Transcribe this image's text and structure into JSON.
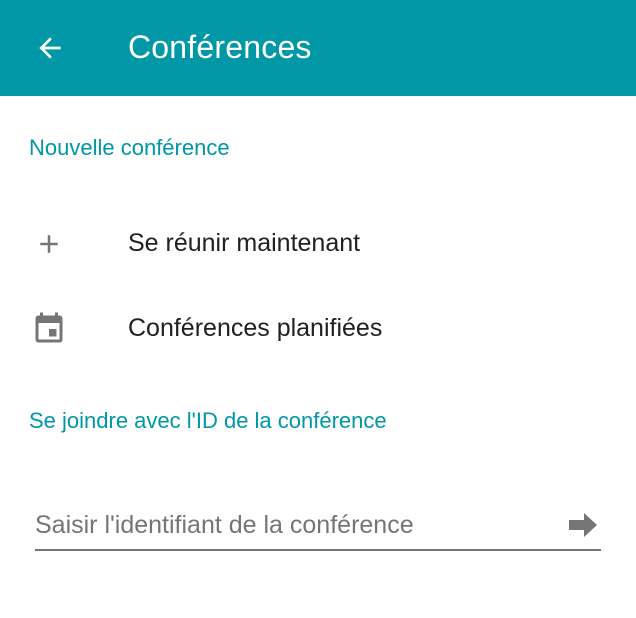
{
  "appbar": {
    "title": "Conférences",
    "back_icon": "arrow-left-icon",
    "background_color": "#0097a7"
  },
  "new_conference": {
    "header": "Nouvelle conférence",
    "items": [
      {
        "label": "Se réunir maintenant",
        "icon": "plus-icon"
      },
      {
        "label": "Conférences planifiées",
        "icon": "calendar-icon"
      }
    ]
  },
  "join": {
    "header": "Se joindre avec l'ID de la conférence",
    "input_value": "",
    "input_placeholder": "Saisir l'identifiant de la conférence",
    "submit_icon": "arrow-right-icon"
  },
  "colors": {
    "accent": "#0097a7",
    "text_primary": "#212121",
    "icon_gray": "#757575"
  }
}
